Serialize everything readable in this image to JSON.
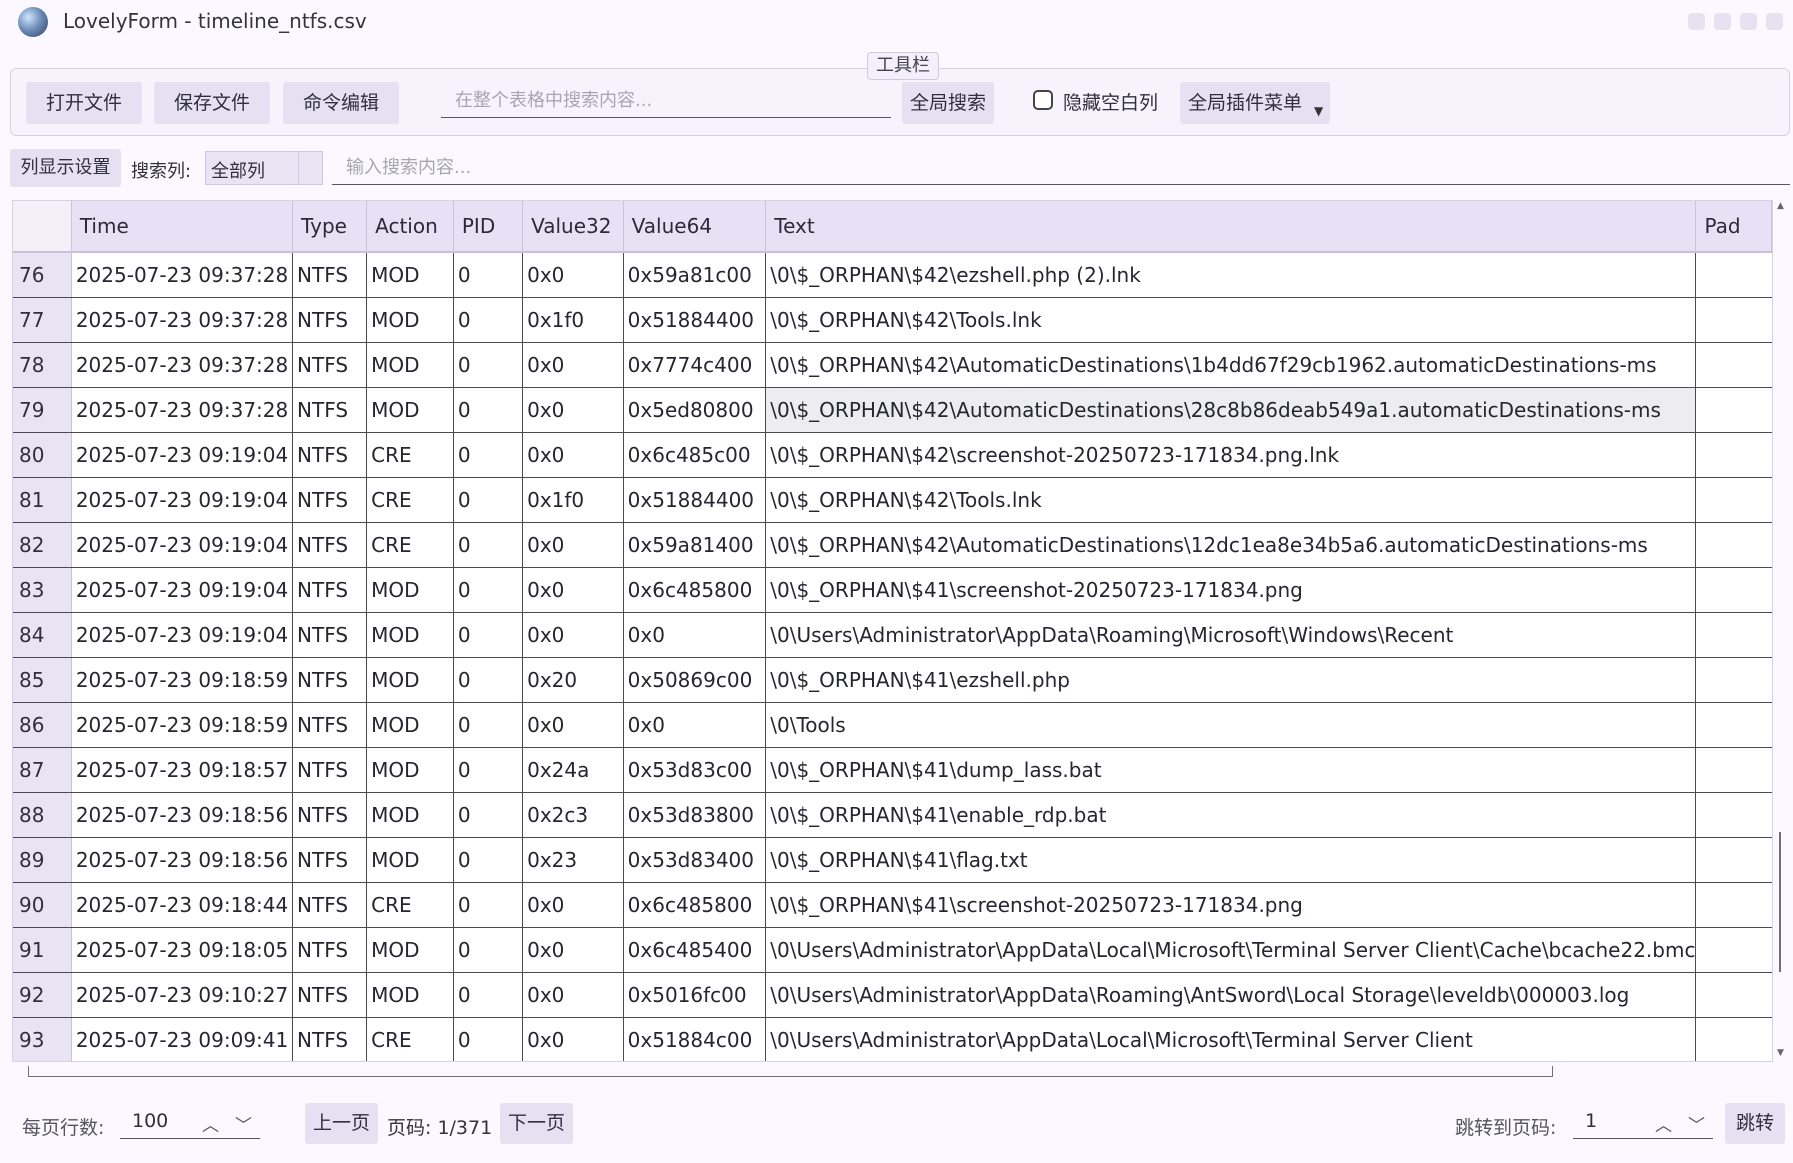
{
  "window": {
    "title": "LovelyForm - timeline_ntfs.csv"
  },
  "toolbar": {
    "legend": "工具栏",
    "open_file": "打开文件",
    "save_file": "保存文件",
    "command_edit": "命令编辑",
    "global_search_placeholder": "在整个表格中搜索内容...",
    "global_search_button": "全局搜索",
    "hide_empty_columns": "隐藏空白列",
    "hide_empty_checked": false,
    "plugin_menu": "全局插件菜单"
  },
  "filter": {
    "column_settings": "列显示设置",
    "search_column_label": "搜索列:",
    "search_column_value": "全部列",
    "search_placeholder": "输入搜索内容..."
  },
  "table": {
    "columns": [
      "Time",
      "Type",
      "Action",
      "PID",
      "Value32",
      "Value64",
      "Text",
      "Pad"
    ],
    "selected_row": "79",
    "rows": [
      [
        "76",
        "2025-07-23 09:37:28",
        "NTFS",
        "MOD",
        "0",
        "0x0",
        "0x59a81c00",
        "\\0\\$_ORPHAN\\$42\\ezshell.php (2).lnk",
        ""
      ],
      [
        "77",
        "2025-07-23 09:37:28",
        "NTFS",
        "MOD",
        "0",
        "0x1f0",
        "0x51884400",
        "\\0\\$_ORPHAN\\$42\\Tools.lnk",
        ""
      ],
      [
        "78",
        "2025-07-23 09:37:28",
        "NTFS",
        "MOD",
        "0",
        "0x0",
        "0x7774c400",
        "\\0\\$_ORPHAN\\$42\\AutomaticDestinations\\1b4dd67f29cb1962.automaticDestinations-ms",
        ""
      ],
      [
        "79",
        "2025-07-23 09:37:28",
        "NTFS",
        "MOD",
        "0",
        "0x0",
        "0x5ed80800",
        "\\0\\$_ORPHAN\\$42\\AutomaticDestinations\\28c8b86deab549a1.automaticDestinations-ms",
        ""
      ],
      [
        "80",
        "2025-07-23 09:19:04",
        "NTFS",
        "CRE",
        "0",
        "0x0",
        "0x6c485c00",
        "\\0\\$_ORPHAN\\$42\\screenshot-20250723-171834.png.lnk",
        ""
      ],
      [
        "81",
        "2025-07-23 09:19:04",
        "NTFS",
        "CRE",
        "0",
        "0x1f0",
        "0x51884400",
        "\\0\\$_ORPHAN\\$42\\Tools.lnk",
        ""
      ],
      [
        "82",
        "2025-07-23 09:19:04",
        "NTFS",
        "CRE",
        "0",
        "0x0",
        "0x59a81400",
        "\\0\\$_ORPHAN\\$42\\AutomaticDestinations\\12dc1ea8e34b5a6.automaticDestinations-ms",
        ""
      ],
      [
        "83",
        "2025-07-23 09:19:04",
        "NTFS",
        "MOD",
        "0",
        "0x0",
        "0x6c485800",
        "\\0\\$_ORPHAN\\$41\\screenshot-20250723-171834.png",
        ""
      ],
      [
        "84",
        "2025-07-23 09:19:04",
        "NTFS",
        "MOD",
        "0",
        "0x0",
        "0x0",
        "\\0\\Users\\Administrator\\AppData\\Roaming\\Microsoft\\Windows\\Recent",
        ""
      ],
      [
        "85",
        "2025-07-23 09:18:59",
        "NTFS",
        "MOD",
        "0",
        "0x20",
        "0x50869c00",
        "\\0\\$_ORPHAN\\$41\\ezshell.php",
        ""
      ],
      [
        "86",
        "2025-07-23 09:18:59",
        "NTFS",
        "MOD",
        "0",
        "0x0",
        "0x0",
        "\\0\\Tools",
        ""
      ],
      [
        "87",
        "2025-07-23 09:18:57",
        "NTFS",
        "MOD",
        "0",
        "0x24a",
        "0x53d83c00",
        "\\0\\$_ORPHAN\\$41\\dump_lass.bat",
        ""
      ],
      [
        "88",
        "2025-07-23 09:18:56",
        "NTFS",
        "MOD",
        "0",
        "0x2c3",
        "0x53d83800",
        "\\0\\$_ORPHAN\\$41\\enable_rdp.bat",
        ""
      ],
      [
        "89",
        "2025-07-23 09:18:56",
        "NTFS",
        "MOD",
        "0",
        "0x23",
        "0x53d83400",
        "\\0\\$_ORPHAN\\$41\\flag.txt",
        ""
      ],
      [
        "90",
        "2025-07-23 09:18:44",
        "NTFS",
        "CRE",
        "0",
        "0x0",
        "0x6c485800",
        "\\0\\$_ORPHAN\\$41\\screenshot-20250723-171834.png",
        ""
      ],
      [
        "91",
        "2025-07-23 09:18:05",
        "NTFS",
        "MOD",
        "0",
        "0x0",
        "0x6c485400",
        "\\0\\Users\\Administrator\\AppData\\Local\\Microsoft\\Terminal Server Client\\Cache\\bcache22.bmc",
        ""
      ],
      [
        "92",
        "2025-07-23 09:10:27",
        "NTFS",
        "MOD",
        "0",
        "0x0",
        "0x5016fc00",
        "\\0\\Users\\Administrator\\AppData\\Roaming\\AntSword\\Local Storage\\leveldb\\000003.log",
        ""
      ],
      [
        "93",
        "2025-07-23 09:09:41",
        "NTFS",
        "CRE",
        "0",
        "0x0",
        "0x51884c00",
        "\\0\\Users\\Administrator\\AppData\\Local\\Microsoft\\Terminal Server Client",
        ""
      ]
    ]
  },
  "pager": {
    "rows_per_page_label": "每页行数:",
    "rows_per_page": "100",
    "prev": "上一页",
    "page_info": "页码: 1/371",
    "next": "下一页",
    "jump_label": "跳转到页码:",
    "jump_value": "1",
    "jump_button": "跳转"
  }
}
